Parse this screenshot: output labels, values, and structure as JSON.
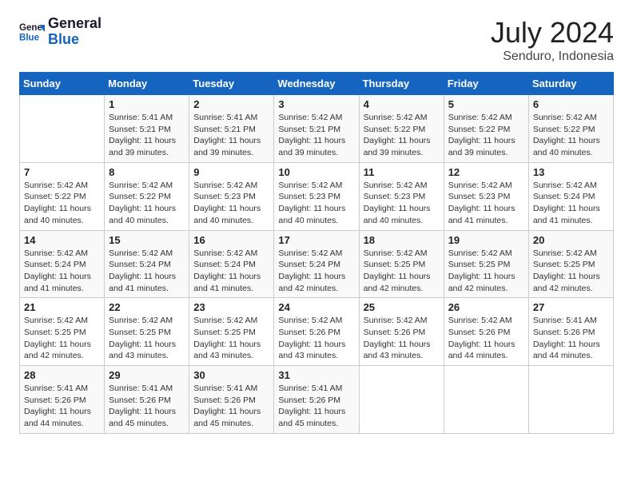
{
  "logo": {
    "text_general": "General",
    "text_blue": "Blue"
  },
  "header": {
    "month": "July 2024",
    "location": "Senduro, Indonesia"
  },
  "days_of_week": [
    "Sunday",
    "Monday",
    "Tuesday",
    "Wednesday",
    "Thursday",
    "Friday",
    "Saturday"
  ],
  "weeks": [
    [
      {
        "day": "",
        "sunrise": "",
        "sunset": "",
        "daylight": ""
      },
      {
        "day": "1",
        "sunrise": "5:41 AM",
        "sunset": "5:21 PM",
        "daylight": "11 hours and 39 minutes."
      },
      {
        "day": "2",
        "sunrise": "5:41 AM",
        "sunset": "5:21 PM",
        "daylight": "11 hours and 39 minutes."
      },
      {
        "day": "3",
        "sunrise": "5:42 AM",
        "sunset": "5:21 PM",
        "daylight": "11 hours and 39 minutes."
      },
      {
        "day": "4",
        "sunrise": "5:42 AM",
        "sunset": "5:22 PM",
        "daylight": "11 hours and 39 minutes."
      },
      {
        "day": "5",
        "sunrise": "5:42 AM",
        "sunset": "5:22 PM",
        "daylight": "11 hours and 39 minutes."
      },
      {
        "day": "6",
        "sunrise": "5:42 AM",
        "sunset": "5:22 PM",
        "daylight": "11 hours and 40 minutes."
      }
    ],
    [
      {
        "day": "7",
        "sunrise": "5:42 AM",
        "sunset": "5:22 PM",
        "daylight": "11 hours and 40 minutes."
      },
      {
        "day": "8",
        "sunrise": "5:42 AM",
        "sunset": "5:22 PM",
        "daylight": "11 hours and 40 minutes."
      },
      {
        "day": "9",
        "sunrise": "5:42 AM",
        "sunset": "5:23 PM",
        "daylight": "11 hours and 40 minutes."
      },
      {
        "day": "10",
        "sunrise": "5:42 AM",
        "sunset": "5:23 PM",
        "daylight": "11 hours and 40 minutes."
      },
      {
        "day": "11",
        "sunrise": "5:42 AM",
        "sunset": "5:23 PM",
        "daylight": "11 hours and 40 minutes."
      },
      {
        "day": "12",
        "sunrise": "5:42 AM",
        "sunset": "5:23 PM",
        "daylight": "11 hours and 41 minutes."
      },
      {
        "day": "13",
        "sunrise": "5:42 AM",
        "sunset": "5:24 PM",
        "daylight": "11 hours and 41 minutes."
      }
    ],
    [
      {
        "day": "14",
        "sunrise": "5:42 AM",
        "sunset": "5:24 PM",
        "daylight": "11 hours and 41 minutes."
      },
      {
        "day": "15",
        "sunrise": "5:42 AM",
        "sunset": "5:24 PM",
        "daylight": "11 hours and 41 minutes."
      },
      {
        "day": "16",
        "sunrise": "5:42 AM",
        "sunset": "5:24 PM",
        "daylight": "11 hours and 41 minutes."
      },
      {
        "day": "17",
        "sunrise": "5:42 AM",
        "sunset": "5:24 PM",
        "daylight": "11 hours and 42 minutes."
      },
      {
        "day": "18",
        "sunrise": "5:42 AM",
        "sunset": "5:25 PM",
        "daylight": "11 hours and 42 minutes."
      },
      {
        "day": "19",
        "sunrise": "5:42 AM",
        "sunset": "5:25 PM",
        "daylight": "11 hours and 42 minutes."
      },
      {
        "day": "20",
        "sunrise": "5:42 AM",
        "sunset": "5:25 PM",
        "daylight": "11 hours and 42 minutes."
      }
    ],
    [
      {
        "day": "21",
        "sunrise": "5:42 AM",
        "sunset": "5:25 PM",
        "daylight": "11 hours and 42 minutes."
      },
      {
        "day": "22",
        "sunrise": "5:42 AM",
        "sunset": "5:25 PM",
        "daylight": "11 hours and 43 minutes."
      },
      {
        "day": "23",
        "sunrise": "5:42 AM",
        "sunset": "5:25 PM",
        "daylight": "11 hours and 43 minutes."
      },
      {
        "day": "24",
        "sunrise": "5:42 AM",
        "sunset": "5:26 PM",
        "daylight": "11 hours and 43 minutes."
      },
      {
        "day": "25",
        "sunrise": "5:42 AM",
        "sunset": "5:26 PM",
        "daylight": "11 hours and 43 minutes."
      },
      {
        "day": "26",
        "sunrise": "5:42 AM",
        "sunset": "5:26 PM",
        "daylight": "11 hours and 44 minutes."
      },
      {
        "day": "27",
        "sunrise": "5:41 AM",
        "sunset": "5:26 PM",
        "daylight": "11 hours and 44 minutes."
      }
    ],
    [
      {
        "day": "28",
        "sunrise": "5:41 AM",
        "sunset": "5:26 PM",
        "daylight": "11 hours and 44 minutes."
      },
      {
        "day": "29",
        "sunrise": "5:41 AM",
        "sunset": "5:26 PM",
        "daylight": "11 hours and 45 minutes."
      },
      {
        "day": "30",
        "sunrise": "5:41 AM",
        "sunset": "5:26 PM",
        "daylight": "11 hours and 45 minutes."
      },
      {
        "day": "31",
        "sunrise": "5:41 AM",
        "sunset": "5:26 PM",
        "daylight": "11 hours and 45 minutes."
      },
      {
        "day": "",
        "sunrise": "",
        "sunset": "",
        "daylight": ""
      },
      {
        "day": "",
        "sunrise": "",
        "sunset": "",
        "daylight": ""
      },
      {
        "day": "",
        "sunrise": "",
        "sunset": "",
        "daylight": ""
      }
    ]
  ]
}
